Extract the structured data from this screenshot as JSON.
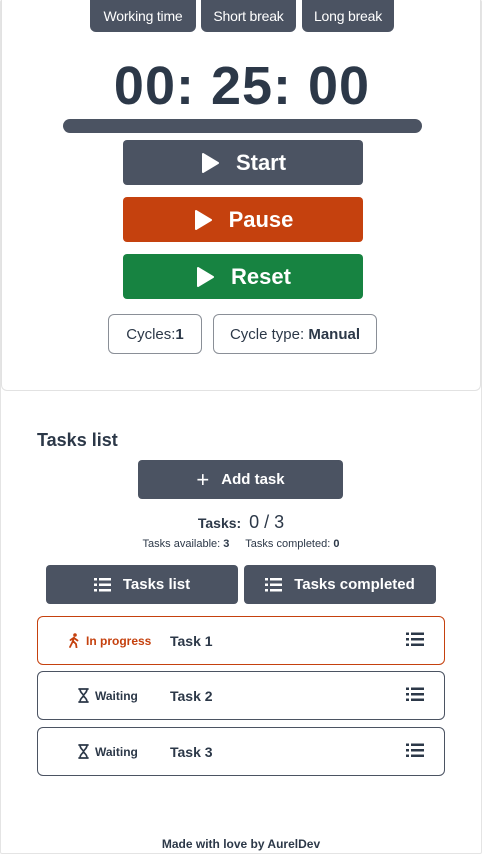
{
  "modes": [
    {
      "label": "Working time"
    },
    {
      "label": "Short break"
    },
    {
      "label": "Long break"
    }
  ],
  "timer": {
    "display": "00: 25: 00",
    "progress_fraction": 1.0
  },
  "controls": {
    "start_label": "Start",
    "pause_label": "Pause",
    "reset_label": "Reset"
  },
  "cycles": {
    "label": "Cycles:",
    "value": "1",
    "type_label": "Cycle type: ",
    "type_value": "Manual"
  },
  "tasks": {
    "heading": "Tasks list",
    "add_label": "Add task",
    "count_label": "Tasks:",
    "count_value": "0 / 3",
    "available_label": "Tasks available:",
    "available_value": "3",
    "completed_label": "Tasks completed:",
    "completed_value": "0",
    "tab_list": "Tasks list",
    "tab_completed": "Tasks completed",
    "items": [
      {
        "status": "In progress",
        "name": "Task 1",
        "status_icon": "walking-person-icon"
      },
      {
        "status": "Waiting",
        "name": "Task 2",
        "status_icon": "hourglass-icon"
      },
      {
        "status": "Waiting",
        "name": "Task 3",
        "status_icon": "hourglass-icon"
      }
    ]
  },
  "footer": "Made with love by AurelDev",
  "colors": {
    "primary": "#4b5362",
    "pause": "#c5410e",
    "reset": "#178341",
    "text": "#2c3848",
    "in_progress": "#c5410e"
  }
}
